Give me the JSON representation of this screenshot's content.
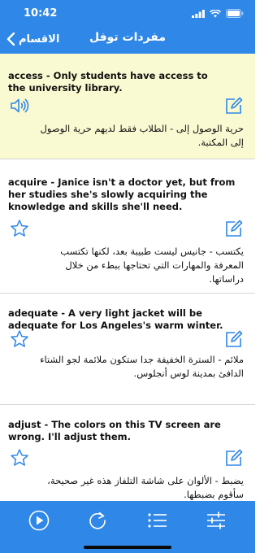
{
  "status_bar": {
    "time": "10:42"
  },
  "nav": {
    "back_label": "الاقسام",
    "title": "مفردات توفل"
  },
  "items": [
    {
      "word": "access - Only students have access to the university library.",
      "translation": "حرية الوصول إلى - الطلاب فقط لديهم حرية الوصول إلى المكتبة.",
      "left_icon": "speaker-icon",
      "right_icon": "edit-icon"
    },
    {
      "word": "acquire - Janice isn't a doctor yet, but from her studies she's slowly acquiring the knowledge and skills she'll need.",
      "translation": "يكتسب - جانيس ليست طبيبة بعد، لكنها تكتسب المعرفة والمهارات التي تحتاجها ببطء من خلال دراساتها.",
      "left_icon": "star-icon",
      "right_icon": "edit-icon"
    },
    {
      "word": "adequate - A very light jacket will be adequate for Los Angeles's warm winter.",
      "translation": "ملائم - السترة الخفيفة جدا ستكون ملائمة لجو الشتاء الدافئ بمدينة لوس أنجلوس.",
      "left_icon": "star-icon",
      "right_icon": "edit-icon"
    },
    {
      "word": "adjust - The colors on this TV screen are wrong. I'll adjust them.",
      "translation": "يضبط - الألوان على شاشة التلفاز هذه غير صحيحة، سأقوم بضبطها.",
      "left_icon": "star-icon",
      "right_icon": "edit-icon"
    }
  ],
  "toolbar": {
    "buttons": [
      "play-icon",
      "repeat-icon",
      "list-icon",
      "settings-sliders-icon"
    ]
  },
  "colors": {
    "accent": "#2f87e8",
    "highlight": "#fafad2"
  }
}
